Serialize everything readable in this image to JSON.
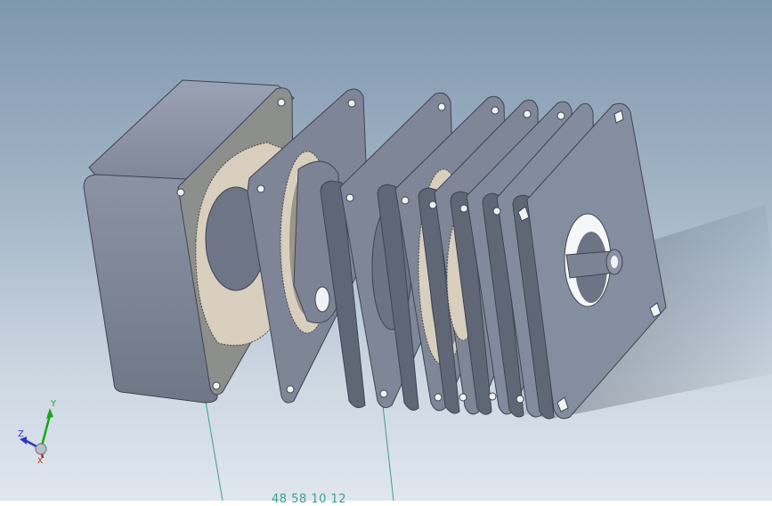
{
  "viewport": {
    "background_top": "#7f97ad",
    "background_bottom": "#dfe6ee"
  },
  "model": {
    "parts": [
      "motor-housing",
      "gasket-plate",
      "carrier-plate-1",
      "carrier-plate-2",
      "ring-gear-plate",
      "spacer-plate-1",
      "spacer-plate-2",
      "output-plate"
    ],
    "body_color": "#7b8395",
    "face_color": "#868ea0",
    "side_color": "#5f6676",
    "gear_color": "#d8cfbf",
    "annotation_color": "#3f9f8a"
  },
  "triad": {
    "y_label": "Y",
    "z_label": "Z",
    "x_label": "X"
  },
  "annotation": {
    "dimension_text": "48 58 10 12"
  }
}
